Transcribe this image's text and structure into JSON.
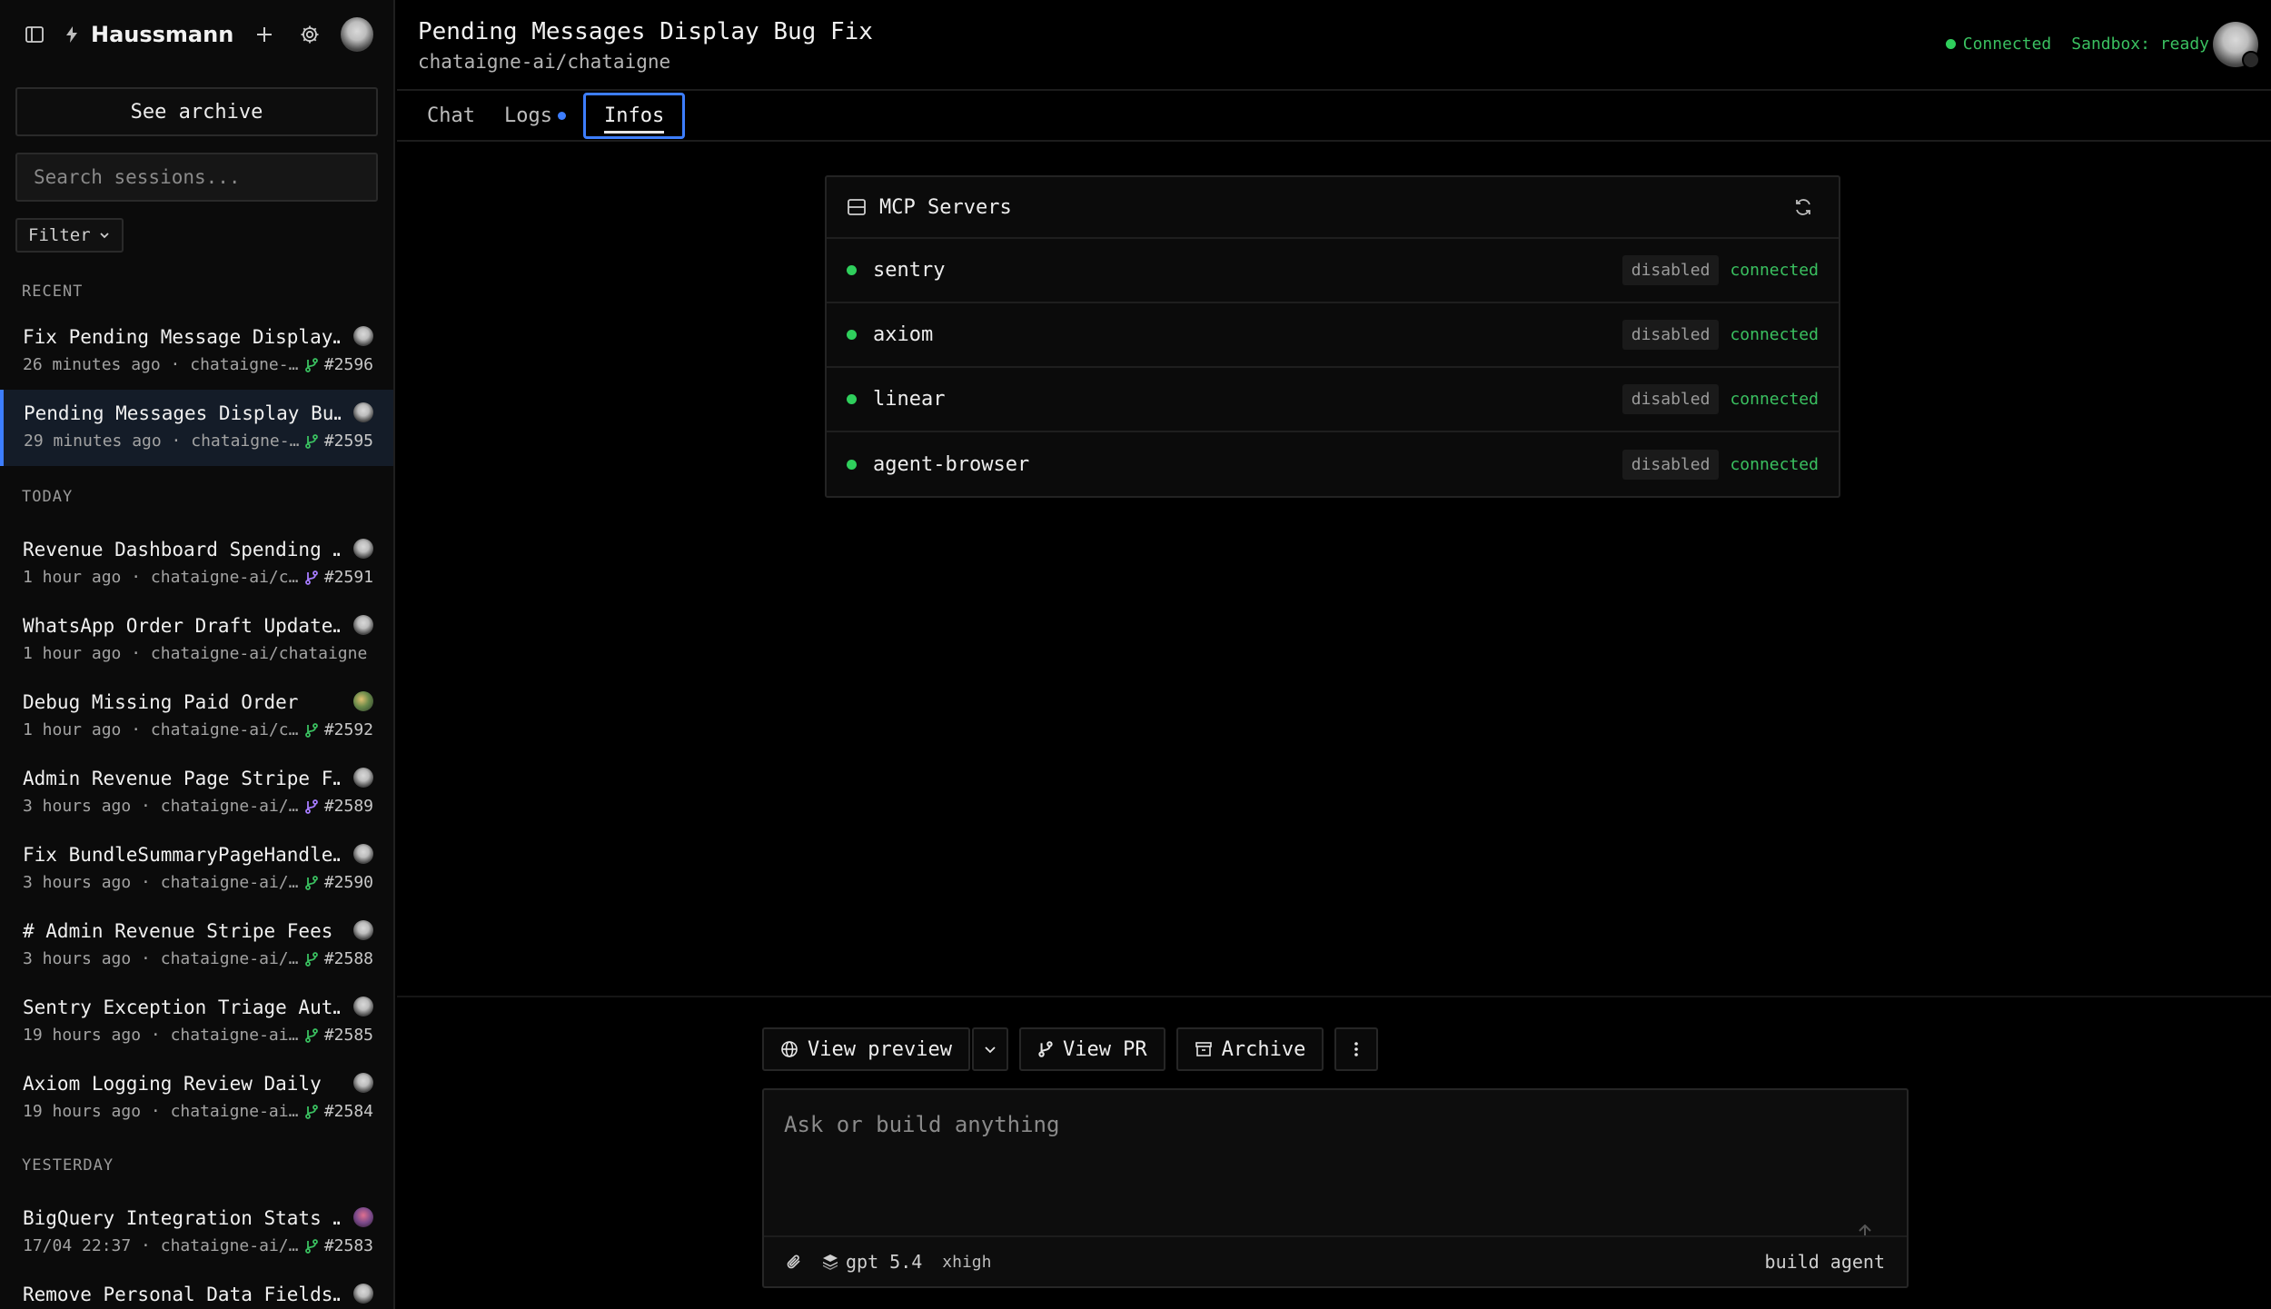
{
  "sidebar": {
    "brand": "Haussmann",
    "see_archive": "See archive",
    "search_placeholder": "Search sessions...",
    "filter_label": "Filter",
    "sections": {
      "recent": "RECENT",
      "today": "TODAY",
      "yesterday": "YESTERDAY"
    },
    "recent": [
      {
        "title": "Fix Pending Message Display…",
        "time": "26 minutes ago",
        "repo": "chataigne-…",
        "pr": "#2596",
        "pr_color": "#3ac060"
      },
      {
        "title": "Pending Messages Display Bu…",
        "time": "29 minutes ago",
        "repo": "chataigne-…",
        "pr": "#2595",
        "pr_color": "#3ac060"
      }
    ],
    "today": [
      {
        "title": "Revenue Dashboard Spending …",
        "time": "1 hour ago",
        "repo": "chataigne-ai/c…",
        "pr": "#2591",
        "pr_color": "#a67cff"
      },
      {
        "title": "WhatsApp Order Draft Update…",
        "time": "1 hour ago",
        "repo": "chataigne-ai/chataigne",
        "pr": "",
        "pr_color": ""
      },
      {
        "title": "Debug Missing Paid Order",
        "time": "1 hour ago",
        "repo": "chataigne-ai/c…",
        "pr": "#2592",
        "pr_color": "#3ac060"
      },
      {
        "title": "Admin Revenue Page Stripe F…",
        "time": "3 hours ago",
        "repo": "chataigne-ai/…",
        "pr": "#2589",
        "pr_color": "#a67cff"
      },
      {
        "title": "Fix BundleSummaryPageHandle…",
        "time": "3 hours ago",
        "repo": "chataigne-ai/…",
        "pr": "#2590",
        "pr_color": "#3ac060"
      },
      {
        "title": "# Admin Revenue Stripe Fees",
        "time": "3 hours ago",
        "repo": "chataigne-ai/…",
        "pr": "#2588",
        "pr_color": "#3ac060"
      },
      {
        "title": "Sentry Exception Triage Aut…",
        "time": "19 hours ago",
        "repo": "chataigne-ai…",
        "pr": "#2585",
        "pr_color": "#3ac060"
      },
      {
        "title": "Axiom Logging Review Daily",
        "time": "19 hours ago",
        "repo": "chataigne-ai…",
        "pr": "#2584",
        "pr_color": "#3ac060"
      }
    ],
    "yesterday": [
      {
        "title": "BigQuery Integration Stats …",
        "time": "17/04 22:37",
        "repo": "chataigne-ai/…",
        "pr": "#2583",
        "pr_color": "#3ac060"
      },
      {
        "title": "Remove Personal Data Fields…",
        "time": "",
        "repo": "",
        "pr": "",
        "pr_color": "#3ac060"
      }
    ]
  },
  "header": {
    "title": "Pending Messages Display Bug Fix",
    "repo": "chataigne-ai/chataigne",
    "status_connected": "Connected",
    "status_sandbox": "Sandbox: ready"
  },
  "tabs": {
    "chat": "Chat",
    "logs": "Logs",
    "infos": "Infos"
  },
  "mcp": {
    "title": "MCP Servers",
    "servers": [
      {
        "name": "sentry",
        "state": "disabled",
        "status": "connected"
      },
      {
        "name": "axiom",
        "state": "disabled",
        "status": "connected"
      },
      {
        "name": "linear",
        "state": "disabled",
        "status": "connected"
      },
      {
        "name": "agent-browser",
        "state": "disabled",
        "status": "connected"
      }
    ]
  },
  "actions": {
    "view_preview": "View preview",
    "view_pr": "View PR",
    "archive": "Archive"
  },
  "composer": {
    "placeholder": "Ask or build anything",
    "model": "gpt 5.4",
    "effort": "xhigh",
    "agent": "build agent"
  },
  "colors": {
    "accent": "#3d7eff",
    "connected": "#3ac060",
    "merged": "#a67cff"
  }
}
